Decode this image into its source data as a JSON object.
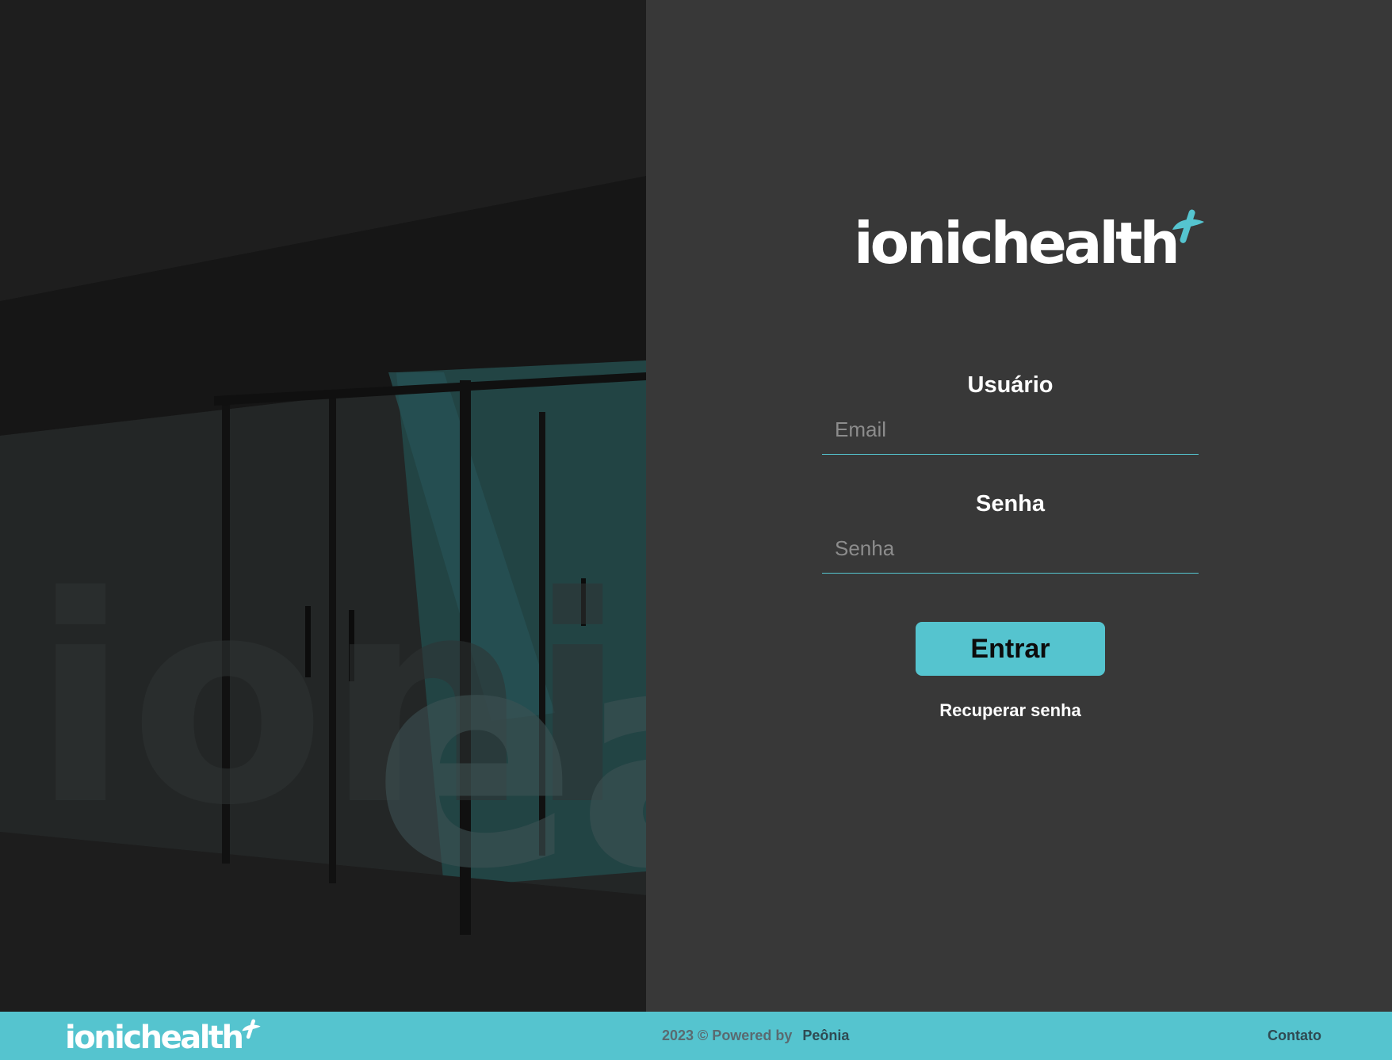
{
  "brand": {
    "name": "ionichealth",
    "accent_color": "#55c4cf",
    "logo_icon": "plus-cross-icon"
  },
  "login": {
    "user_label": "Usuário",
    "email_placeholder": "Email",
    "email_value": "",
    "password_label": "Senha",
    "password_placeholder": "Senha",
    "password_value": "",
    "submit_label": "Entrar",
    "recover_label": "Recuperar senha"
  },
  "footer": {
    "copyright": "2023 © Powered by",
    "powered_brand": "Peônia",
    "contact_label": "Contato"
  },
  "colors": {
    "panel_background": "#383838",
    "footer_background": "#55c4cf",
    "button_background": "#55c4cf"
  }
}
